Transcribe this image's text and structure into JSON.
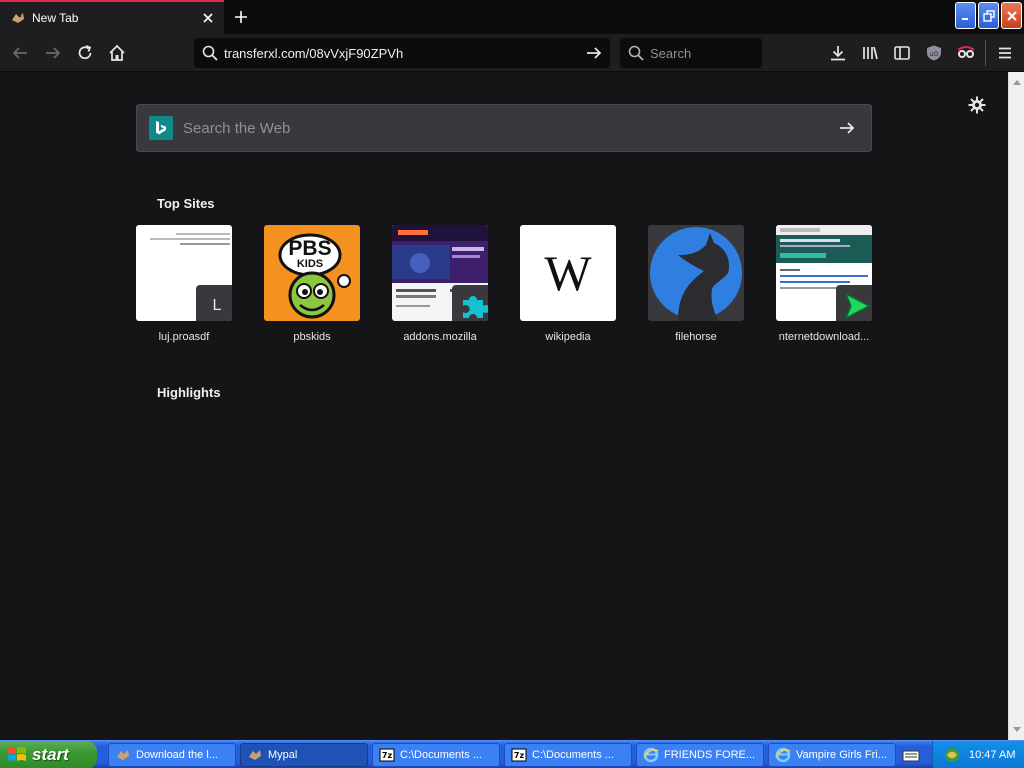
{
  "browser": {
    "tab": {
      "title": "New Tab"
    },
    "url": "transferxl.com/08vVxjF90ZPVh",
    "search_placeholder": "Search"
  },
  "newtab": {
    "websearch_placeholder": "Search the Web",
    "top_sites_title": "Top Sites",
    "highlights_title": "Highlights",
    "sites": [
      {
        "label": "luj.proasdf",
        "badge": "L"
      },
      {
        "label": "pbskids",
        "logo_line1": "PBS",
        "logo_line2": "KIDS"
      },
      {
        "label": "addons.mozilla"
      },
      {
        "label": "wikipedia",
        "logo": "W"
      },
      {
        "label": "filehorse"
      },
      {
        "label": "nternetdownload..."
      }
    ]
  },
  "taskbar": {
    "start": "start",
    "tasks": [
      {
        "label": "Download the l..."
      },
      {
        "label": "Mypal"
      },
      {
        "label": "C:\\Documents ..."
      },
      {
        "label": "C:\\Documents ..."
      },
      {
        "label": "FRIENDS FORE..."
      },
      {
        "label": "Vampire Girls Fri..."
      }
    ],
    "clock": "10:47 AM"
  },
  "colors": {
    "tab_accent": "#e22850",
    "content_bg": "#151517",
    "taskbar_blue": "#245edb",
    "start_green": "#3c9a32"
  }
}
